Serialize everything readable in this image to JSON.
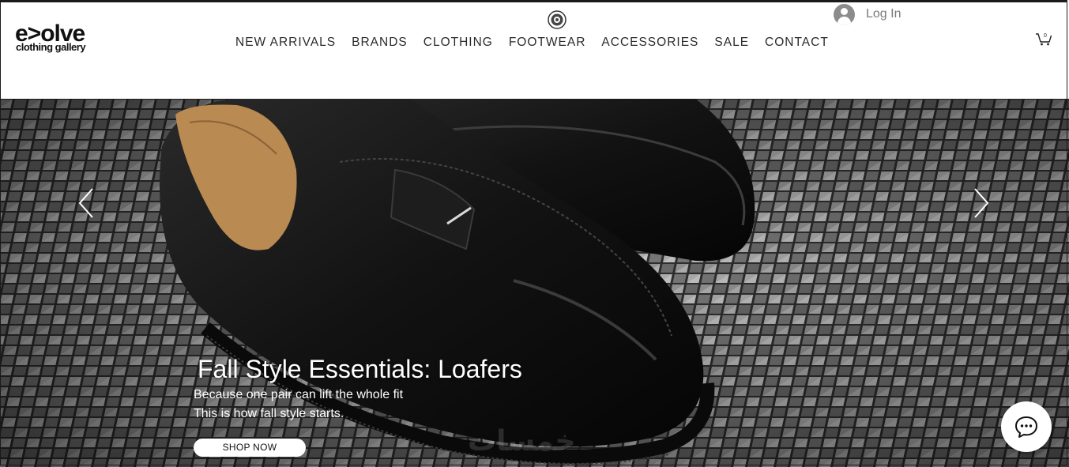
{
  "logo": {
    "word": "e>olve",
    "sub": "clothing gallery"
  },
  "nav": {
    "items": [
      {
        "label": "NEW ARRIVALS"
      },
      {
        "label": "BRANDS"
      },
      {
        "label": "CLOTHING"
      },
      {
        "label": "FOOTWEAR"
      },
      {
        "label": "ACCESSORIES"
      },
      {
        "label": "SALE"
      },
      {
        "label": "CONTACT"
      }
    ]
  },
  "account": {
    "login_label": "Log In"
  },
  "cart": {
    "count": "0"
  },
  "hero": {
    "title": "Fall Style Essentials: Loafers",
    "line1": "Because one pair can lift the whole fit",
    "line2": "This is how fall style starts.",
    "cta_label": "SHOP NOW",
    "watermark": "خمسات"
  },
  "icons": {
    "avatar": "user-avatar-icon",
    "cart": "shopping-cart-icon",
    "prev": "chevron-left-icon",
    "next": "chevron-right-icon",
    "chat": "chat-bubble-icon",
    "badge": "brand-badge-icon"
  },
  "colors": {
    "nav_text": "#2b2b2b",
    "login_text": "#7a7a7a",
    "hero_text": "#ffffff"
  }
}
